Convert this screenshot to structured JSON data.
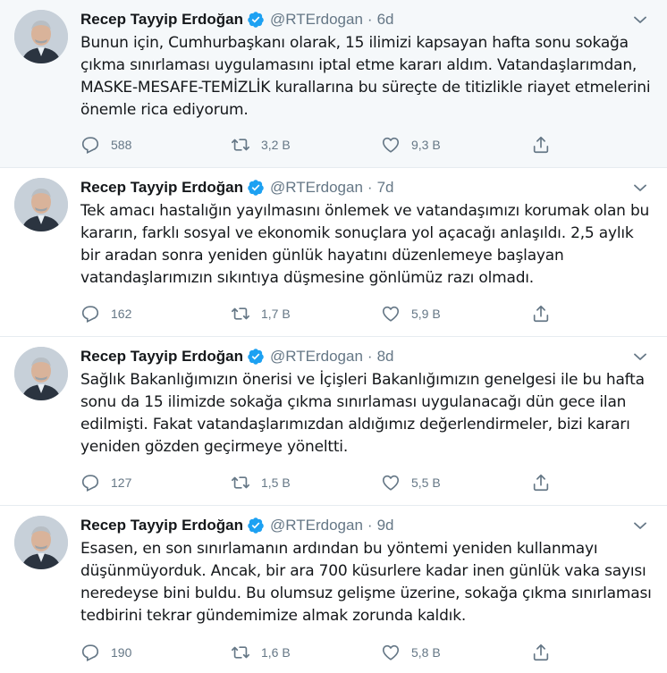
{
  "tweets": [
    {
      "author": "Recep Tayyip Erdoğan",
      "handle": "@RTErdogan",
      "separator": "·",
      "time": "6d",
      "text": "Bunun için, Cumhurbaşkanı olarak, 15 ilimizi kapsayan hafta sonu sokağa çıkma sınırlaması uygulamasını iptal etme kararı aldım. Vatandaşlarımdan, MASKE-MESAFE-TEMİZLİK kurallarına bu süreçte de titizlikle riayet etmelerini önemle rica ediyorum.",
      "replies": "588",
      "retweets": "3,2 B",
      "likes": "9,3 B"
    },
    {
      "author": "Recep Tayyip Erdoğan",
      "handle": "@RTErdogan",
      "separator": "·",
      "time": "7d",
      "text": "Tek amacı hastalığın yayılmasını önlemek ve vatandaşımızı korumak olan bu kararın, farklı sosyal ve ekonomik sonuçlara yol açacağı anlaşıldı. 2,5 aylık bir aradan sonra yeniden günlük hayatını düzenlemeye başlayan vatandaşlarımızın sıkıntıya düşmesine gönlümüz razı olmadı.",
      "replies": "162",
      "retweets": "1,7 B",
      "likes": "5,9 B"
    },
    {
      "author": "Recep Tayyip Erdoğan",
      "handle": "@RTErdogan",
      "separator": "·",
      "time": "8d",
      "text": "Sağlık Bakanlığımızın önerisi ve İçişleri Bakanlığımızın genelgesi ile bu hafta sonu da 15 ilimizde sokağa çıkma sınırlaması uygulanacağı dün gece ilan edilmişti. Fakat vatandaşlarımızdan aldığımız değerlendirmeler, bizi kararı yeniden gözden geçirmeye yöneltti.",
      "replies": "127",
      "retweets": "1,5 B",
      "likes": "5,5 B"
    },
    {
      "author": "Recep Tayyip Erdoğan",
      "handle": "@RTErdogan",
      "separator": "·",
      "time": "9d",
      "text": "Esasen, en son sınırlamanın ardından bu yöntemi yeniden kullanmayı düşünmüyorduk. Ancak, bir ara 700 küsurlere kadar inen günlük vaka sayısı neredeyse bini buldu. Bu olumsuz gelişme üzerine, sokağa çıkma sınırlaması tedbirini tekrar gündemimize almak zorunda kaldık.",
      "replies": "190",
      "retweets": "1,6 B",
      "likes": "5,8 B"
    }
  ],
  "icons": {
    "reply": "reply-icon",
    "retweet": "retweet-icon",
    "like": "heart-icon",
    "share": "share-icon",
    "verified": "verified-badge-icon",
    "more": "chevron-down-icon"
  },
  "colors": {
    "text": "#14171a",
    "secondary": "#657786",
    "verified": "#1da1f2",
    "highlight_bg": "#f5f8fa",
    "divider": "#e6ecf0"
  }
}
